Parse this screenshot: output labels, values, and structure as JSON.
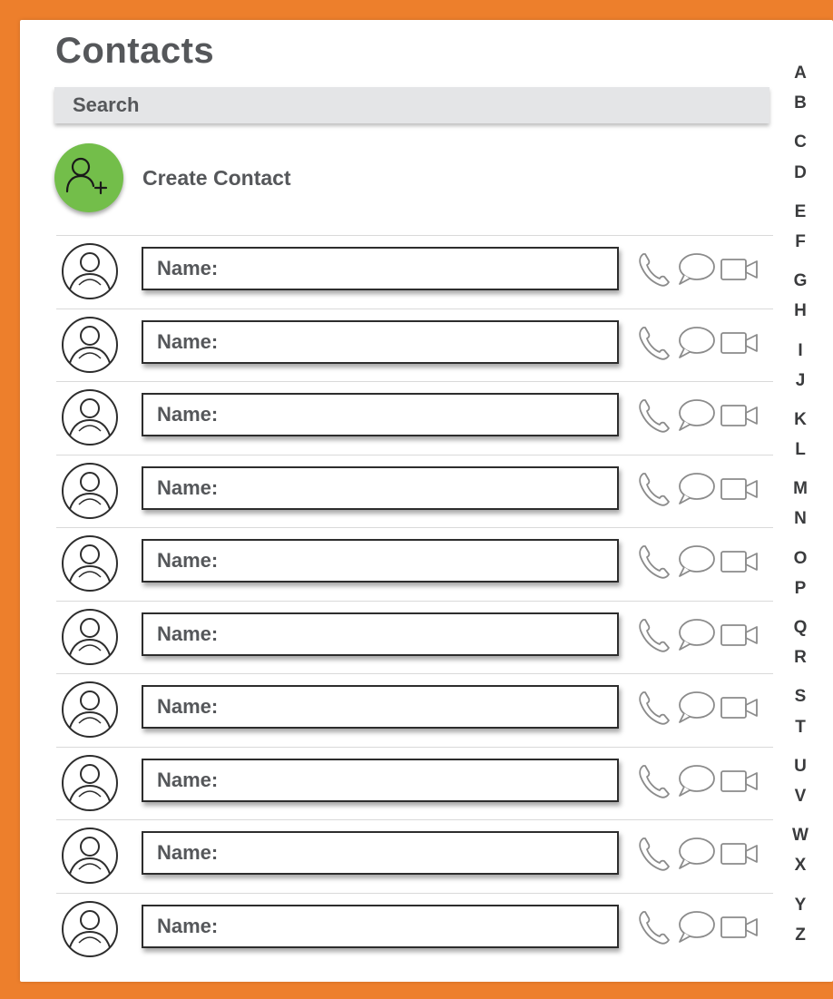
{
  "header": {
    "title": "Contacts"
  },
  "search": {
    "placeholder": "Search"
  },
  "create": {
    "label": "Create Contact"
  },
  "contacts": [
    {
      "name_label": "Name:"
    },
    {
      "name_label": "Name:"
    },
    {
      "name_label": "Name:"
    },
    {
      "name_label": "Name:"
    },
    {
      "name_label": "Name:"
    },
    {
      "name_label": "Name:"
    },
    {
      "name_label": "Name:"
    },
    {
      "name_label": "Name:"
    },
    {
      "name_label": "Name:"
    },
    {
      "name_label": "Name:"
    }
  ],
  "row_icons": [
    "phone-icon",
    "chat-bubble-icon",
    "video-camera-icon"
  ],
  "alphabet": [
    "A",
    "B",
    "C",
    "D",
    "E",
    "F",
    "G",
    "H",
    "I",
    "J",
    "K",
    "L",
    "M",
    "N",
    "O",
    "P",
    "Q",
    "R",
    "S",
    "T",
    "U",
    "V",
    "W",
    "X",
    "Y",
    "Z"
  ],
  "colors": {
    "frame": "#ED7F2C",
    "create_button": "#73BE4A",
    "text": "#55575A",
    "search_bg": "#E4E5E7"
  }
}
